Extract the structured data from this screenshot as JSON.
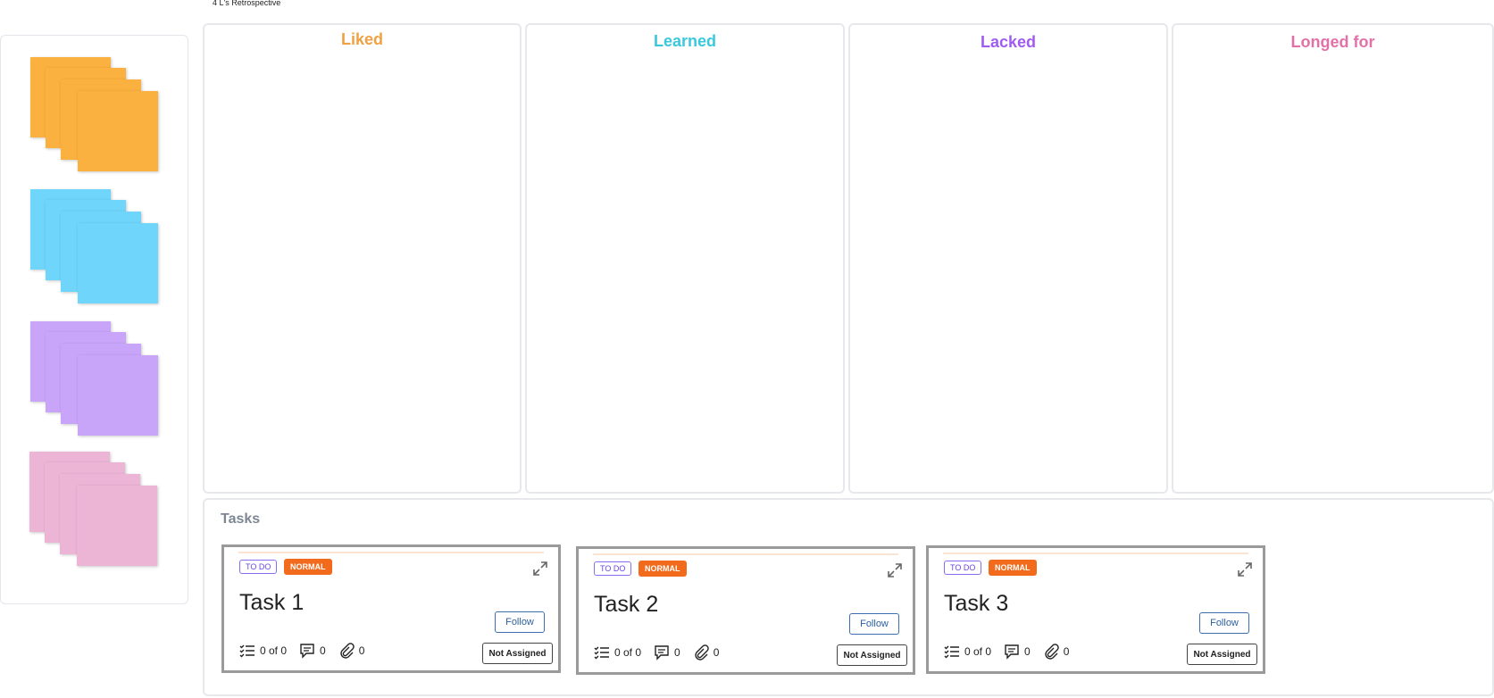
{
  "board": {
    "title": "4 L's Retrospective"
  },
  "palette": {
    "stacks": [
      {
        "icon": "sticky-note-stack-orange",
        "color": "#fbb13f"
      },
      {
        "icon": "sticky-note-stack-blue",
        "color": "#6fd5fb"
      },
      {
        "icon": "sticky-note-stack-purple",
        "color": "#c9a5fa"
      },
      {
        "icon": "sticky-note-stack-pink",
        "color": "#ecb5d6"
      }
    ]
  },
  "columns": [
    {
      "title": "Liked",
      "color": "#f0a143"
    },
    {
      "title": "Learned",
      "color": "#3ac8dd"
    },
    {
      "title": "Lacked",
      "color": "#a05cf0"
    },
    {
      "title": "Longed for",
      "color": "#e371a8"
    }
  ],
  "tasks": {
    "title": "Tasks",
    "cards": [
      {
        "status": "TO DO",
        "priority": "NORMAL",
        "name": "Task 1",
        "checklist": "0 of 0",
        "comments": "0",
        "attachments": "0",
        "follow_label": "Follow",
        "assignee_label": "Not Assigned"
      },
      {
        "status": "TO DO",
        "priority": "NORMAL",
        "name": "Task 2",
        "checklist": "0 of 0",
        "comments": "0",
        "attachments": "0",
        "follow_label": "Follow",
        "assignee_label": "Not Assigned"
      },
      {
        "status": "TO DO",
        "priority": "NORMAL",
        "name": "Task 3",
        "checklist": "0 of 0",
        "comments": "0",
        "attachments": "0",
        "follow_label": "Follow",
        "assignee_label": "Not Assigned"
      }
    ]
  },
  "colors": {
    "status_badge": "#6a46e4",
    "priority_badge": "#f26a1b",
    "follow_button": "#2d5fa0"
  }
}
